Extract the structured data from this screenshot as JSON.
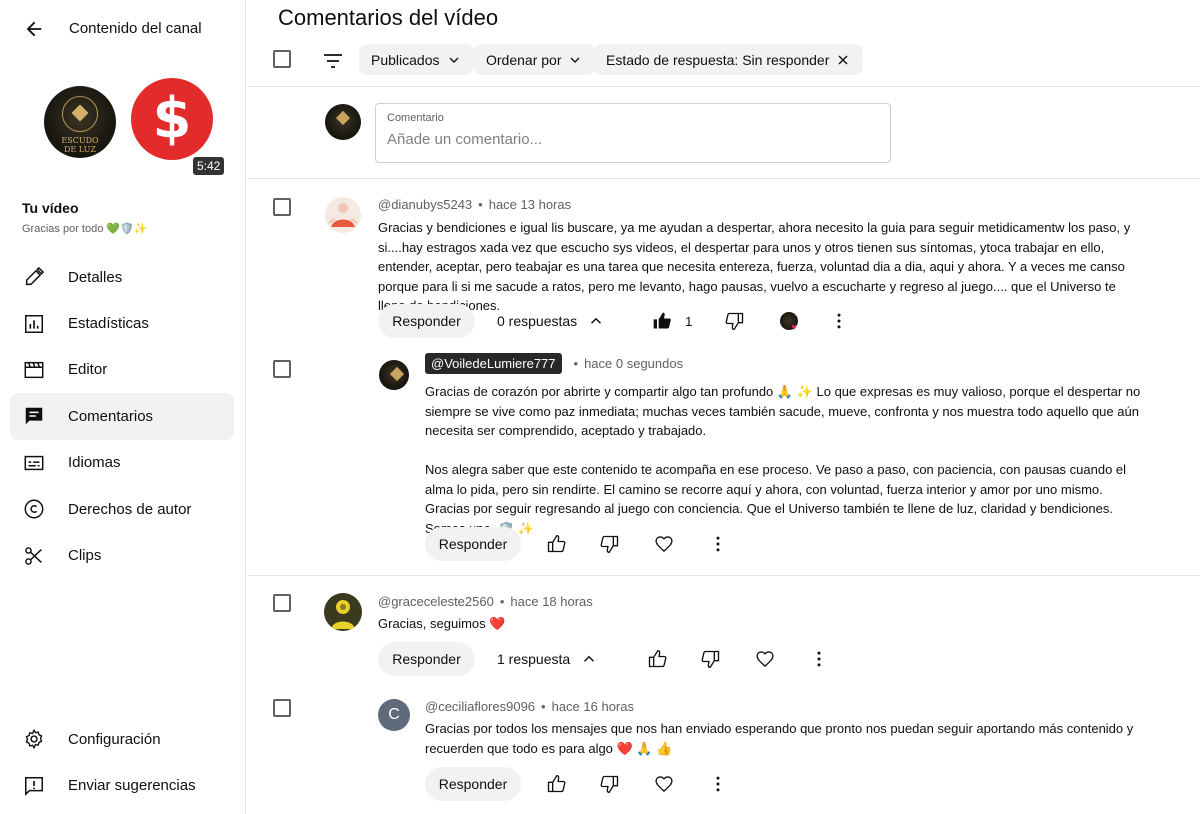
{
  "sidebar": {
    "title": "Contenido del canal",
    "logo_text_top": "ESCUDO",
    "logo_text_bottom": "DE LUZ",
    "thumbnail_symbol": "$",
    "duration": "5:42",
    "your_video": "Tu vídeo",
    "video_title": "Gracias por todo 💚🛡️✨",
    "nav": [
      {
        "label": "Detalles",
        "icon": "pencil-icon"
      },
      {
        "label": "Estadísticas",
        "icon": "analytics-icon"
      },
      {
        "label": "Editor",
        "icon": "editor-icon"
      },
      {
        "label": "Comentarios",
        "icon": "comments-icon",
        "active": true
      },
      {
        "label": "Idiomas",
        "icon": "subtitles-icon"
      },
      {
        "label": "Derechos de autor",
        "icon": "copyright-icon"
      },
      {
        "label": "Clips",
        "icon": "scissors-icon"
      }
    ],
    "bottom_nav": [
      {
        "label": "Configuración",
        "icon": "gear-icon"
      },
      {
        "label": "Enviar sugerencias",
        "icon": "feedback-icon"
      }
    ]
  },
  "main": {
    "title": "Comentarios del vídeo",
    "filters": {
      "published": "Publicados",
      "sort": "Ordenar por",
      "response_state": "Estado de respuesta: Sin responder"
    },
    "add_comment": {
      "label": "Comentario",
      "placeholder": "Añade un comentario..."
    },
    "reply_label": "Responder",
    "comments": [
      {
        "handle": "@dianubys5243",
        "time": "hace 13 horas",
        "text": "Gracias y bendiciones e igual lis buscare, ya me ayudan a despertar, ahora necesito la guia para seguir metidicamentw los paso, y si....hay estragos xada vez que escucho sys videos, el despertar para unos y otros tienen sus síntomas, ytoca trabajar en ello, entender, aceptar, pero teabajar es una tarea que necesita entereza, fuerza, voluntad dia a dia, aqui y ahora. Y a veces me canso porque para li si me sacude a ratos, pero me levanto, hago pausas, vuelvo a escucharte y regreso al juego.... que el Universo te llene de bendiciones.",
        "replies_label": "0 respuestas",
        "likes": "1"
      },
      {
        "handle": "@VoiledeLumiere777",
        "time": "hace 0 segundos",
        "text_p1": "Gracias de corazón por abrirte y compartir algo tan profundo 🙏 ✨ Lo que expresas es muy valioso, porque el despertar no siempre se vive como paz inmediata; muchas veces también sacude, mueve, confronta y nos muestra todo aquello que aún necesita ser comprendido, aceptado y trabajado.",
        "text_p2": "Nos alegra saber que este contenido te acompaña en ese proceso. Ve paso a paso, con paciencia, con pausas cuando el alma lo pida, pero sin rendirte. El camino se recorre aquí y ahora, con voluntad, fuerza interior y amor por uno mismo. Gracias por seguir regresando al juego con conciencia. Que el Universo también te llene de luz, claridad y bendiciones. Somos uno. 🛡️ ✨"
      },
      {
        "handle": "@graceceleste2560",
        "time": "hace 18 horas",
        "text": "Gracias, seguimos ❤️",
        "replies_label": "1 respuesta"
      },
      {
        "handle": "@ceciliaflores9096",
        "avatar_letter": "C",
        "time": "hace 16 horas",
        "text": "Gracias por todos los mensajes que nos han enviado esperando que pronto nos puedan seguir aportando más contenido y recuerden que todo es para algo ❤️ 🙏 👍"
      }
    ]
  }
}
